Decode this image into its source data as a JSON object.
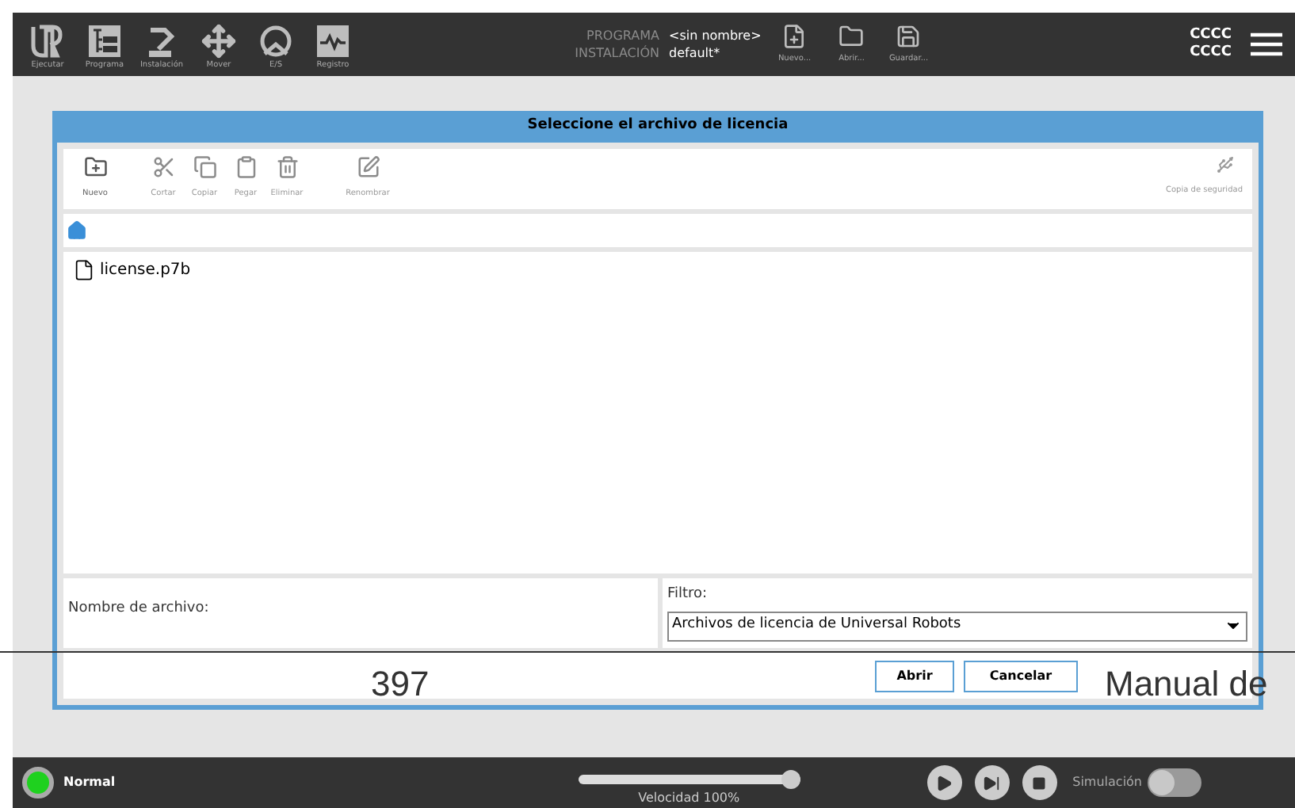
{
  "header": {
    "nav": [
      {
        "label": "Ejecutar",
        "selected": false
      },
      {
        "label": "Programa",
        "selected": false
      },
      {
        "label": "Instalación",
        "selected": false
      },
      {
        "label": "Mover",
        "selected": false
      },
      {
        "label": "E/S",
        "selected": false
      },
      {
        "label": "Registro",
        "selected": false
      }
    ],
    "program_label": "PROGRAMA",
    "program_value": "<sin nombre>",
    "installation_label": "INSTALACIÓN",
    "installation_value": "default*",
    "file_actions": [
      "Nuevo...",
      "Abrir...",
      "Guardar..."
    ],
    "status_top": "CCCC",
    "status_bottom": "CCCC"
  },
  "dialog": {
    "title": "Seleccione el archivo de licencia",
    "toolbar": [
      {
        "label": "Nuevo",
        "disabled": false
      },
      {
        "label": "Cortar",
        "disabled": true
      },
      {
        "label": "Copiar",
        "disabled": true
      },
      {
        "label": "Pegar",
        "disabled": true
      },
      {
        "label": "Eliminar",
        "disabled": true
      },
      {
        "label": "Renombrar",
        "disabled": true
      }
    ],
    "backup": {
      "label": "Copia de seguridad",
      "disabled": true
    },
    "files": [
      {
        "name": "license.p7b",
        "selected": false
      }
    ],
    "filename_label": "Nombre de archivo:",
    "filter_label": "Filtro:",
    "filter_value": "Archivos de licencia de Universal Robots",
    "buttons": [
      "Abrir",
      "Cancelar"
    ]
  },
  "page_overlay": {
    "page_number": "397",
    "footer_text": "Manual de"
  },
  "footer": {
    "status": "Normal",
    "speed": {
      "level": 1,
      "label": "Velocidad 100%"
    },
    "simulation_label": "Simulación",
    "simulation_on": false
  }
}
